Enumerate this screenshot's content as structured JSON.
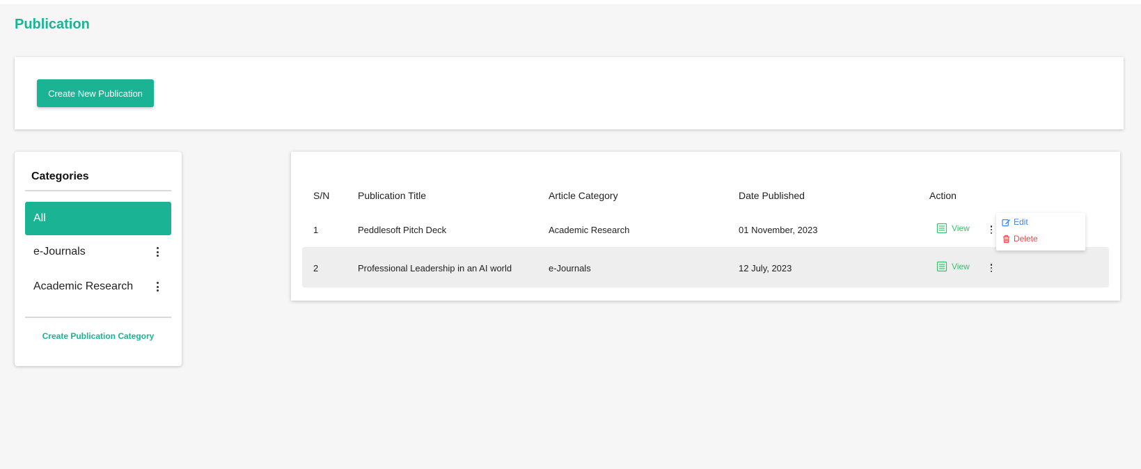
{
  "page": {
    "title": "Publication"
  },
  "toolbar": {
    "create_publication_label": "Create New Publication"
  },
  "categories": {
    "heading": "Categories",
    "items": [
      {
        "label": "All",
        "active": true
      },
      {
        "label": "e-Journals",
        "active": false
      },
      {
        "label": "Academic Research",
        "active": false
      }
    ],
    "create_label": "Create Publication Category"
  },
  "table": {
    "headers": [
      "S/N",
      "Publication Title",
      "Article Category",
      "Date Published",
      "Action"
    ],
    "rows": [
      {
        "sn": "1",
        "title": "Peddlesoft Pitch Deck",
        "category": "Academic Research",
        "date": "01 November, 2023",
        "action": "View"
      },
      {
        "sn": "2",
        "title": "Professional Leadership in an AI world",
        "category": "e-Journals",
        "date": "12 July, 2023",
        "action": "View"
      }
    ]
  },
  "action_menu": {
    "edit_label": "Edit",
    "delete_label": "Delete"
  },
  "colors": {
    "accent": "#1ab394",
    "view": "#34c46a",
    "edit": "#3b82f6",
    "delete": "#ef4444"
  },
  "icons": {
    "view": "document-list-icon",
    "edit": "edit-icon",
    "delete": "trash-icon",
    "menu": "kebab-menu-icon"
  }
}
